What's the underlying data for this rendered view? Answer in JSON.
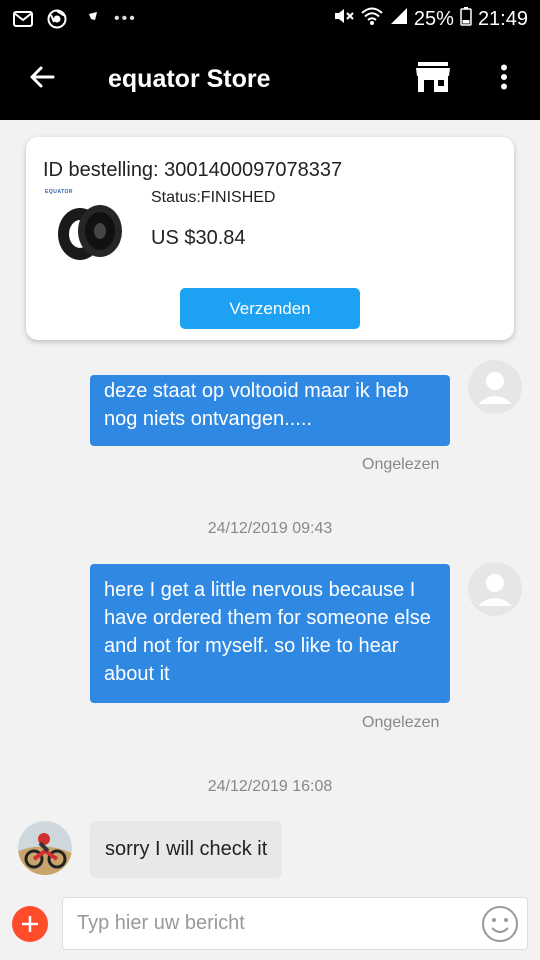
{
  "status_bar": {
    "battery": "25%",
    "time": "21:49",
    "icons": [
      "gmail-icon",
      "chrome-icon",
      "notification-icon",
      "more-notifications-icon",
      "mute-icon",
      "wifi-icon",
      "signal-icon",
      "battery-icon"
    ]
  },
  "header": {
    "title": "equator Store",
    "icons": [
      "back-arrow-icon",
      "store-icon",
      "more-vert-icon"
    ]
  },
  "order": {
    "id_text": "ID bestelling: 3001400097078337",
    "brand": "EQUATOR",
    "status": "Status:FINISHED",
    "price": "US $30.84",
    "button_label": "Verzenden"
  },
  "messages": [
    {
      "direction": "out",
      "text": "deze staat op voltooid maar ik heb nog niets ontvangen.....",
      "status": "Ongelezen"
    },
    {
      "direction": "out",
      "timestamp": "24/12/2019 09:43",
      "text": "here I get a little nervous because I have ordered them for someone else and not for myself. so like to hear about it",
      "status": "Ongelezen"
    },
    {
      "direction": "in",
      "timestamp": "24/12/2019 16:08",
      "text": "sorry I will check it"
    }
  ],
  "composer": {
    "placeholder": "Typ hier uw bericht",
    "icons": [
      "add-icon",
      "emoji-icon"
    ]
  },
  "colors": {
    "accent": "#1da1f2",
    "outgoing_bubble": "#2f89e3",
    "incoming_bubble": "#e8e8e8",
    "add_button": "#ff4c2b",
    "header_bg": "#000000"
  }
}
